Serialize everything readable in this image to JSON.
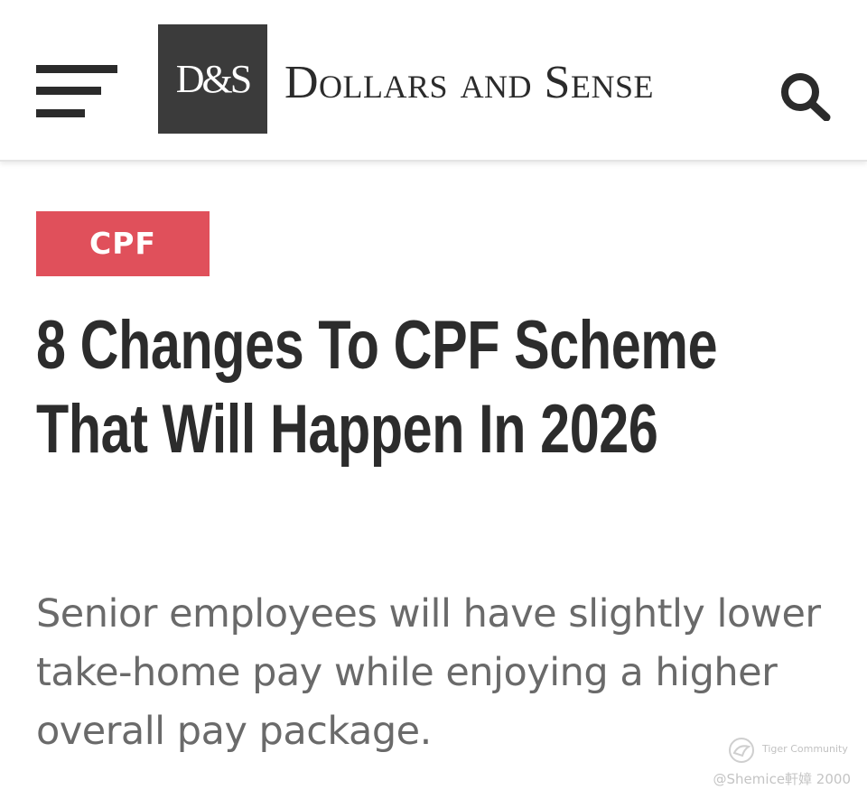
{
  "header": {
    "logo_mark": "D&S",
    "logo_wordmark": "Dollars and Sense",
    "menu_icon": "hamburger-menu-icon",
    "search_icon": "search-icon"
  },
  "article": {
    "category": "CPF",
    "title": "8 Changes To CPF Scheme That Will Happen In 2026",
    "subtitle": "Senior employees will have slightly lower take-home pay while enjoying a higher overall pay package."
  },
  "watermark": {
    "logo_text": "Tiger Community",
    "credit": "@Shemice軒嫜 2000"
  },
  "colors": {
    "header_bg": "#ffffff",
    "logo_bg": "#3b3b3b",
    "badge_bg": "#e0505b",
    "title_text": "#2c2c2c",
    "subtitle_text": "#6a6a6a"
  }
}
